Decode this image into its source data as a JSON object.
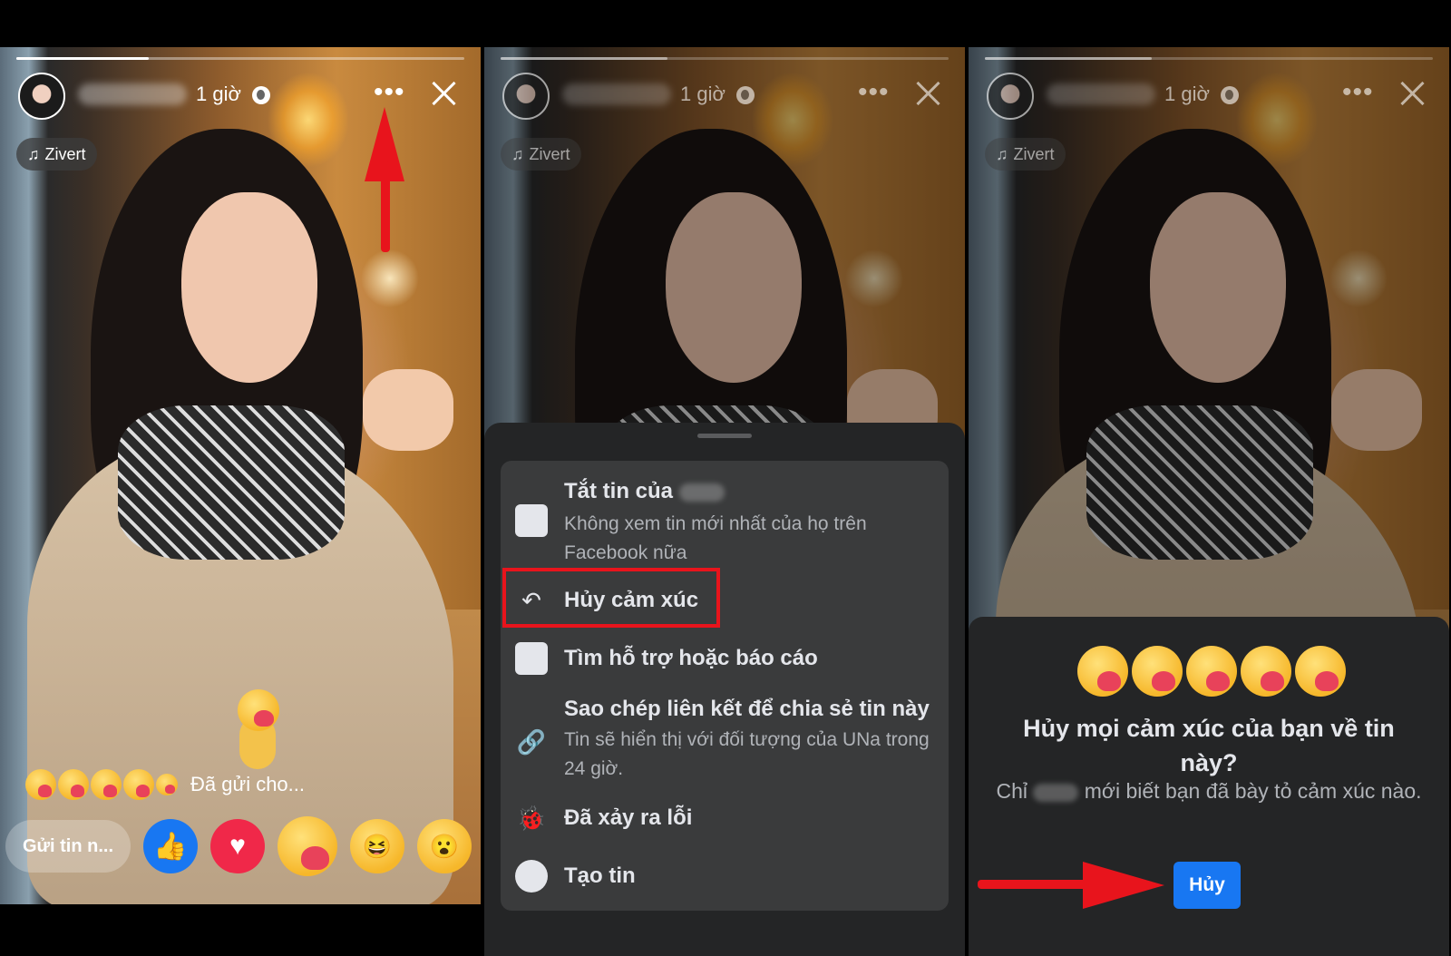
{
  "story": {
    "time": "1 giờ",
    "music": "Zivert",
    "more_icon": "•••",
    "reply_placeholder": "Gửi tin n...",
    "sent_text": "Đã gửi cho..."
  },
  "menu": {
    "mute_title": "Tắt tin của",
    "mute_sub": "Không xem tin mới nhất của họ trên Facebook nữa",
    "undo_reaction": "Hủy cảm xúc",
    "report": "Tìm hỗ trợ hoặc báo cáo",
    "copy_link_title": "Sao chép liên kết để chia sẻ tin này",
    "copy_link_sub": "Tin sẽ hiển thị với đối tượng của UNa trong 24 giờ.",
    "error": "Đã xảy ra lỗi",
    "create": "Tạo tin"
  },
  "dialog": {
    "question": "Hủy mọi cảm xúc của bạn về tin này?",
    "desc_prefix": "Chỉ",
    "desc_suffix": "mới biết bạn đã bày tỏ cảm xúc nào.",
    "confirm": "Hủy"
  },
  "colors": {
    "accent": "#1877f2",
    "highlight": "#e8141c",
    "sheet_bg": "#242526",
    "menu_bg": "#3a3b3c"
  }
}
